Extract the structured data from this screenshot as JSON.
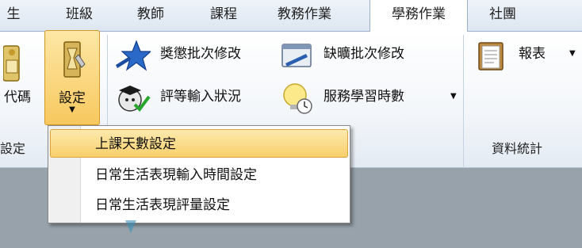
{
  "tabs": [
    {
      "label": "生"
    },
    {
      "label": "班級"
    },
    {
      "label": "教師"
    },
    {
      "label": "課程"
    },
    {
      "label": "教務作業"
    },
    {
      "label": "學務作業"
    },
    {
      "label": "社團"
    }
  ],
  "ribbon": {
    "code_button": {
      "label": "代碼"
    },
    "settings_button": {
      "label": "設定"
    },
    "reward_batch": {
      "label": "獎懲批次修改"
    },
    "absence_batch": {
      "label": "缺曠批次修改"
    },
    "rating_status": {
      "label": "評等輸入狀況"
    },
    "service_hours": {
      "label": "服務學習時數"
    },
    "report": {
      "label": "報表"
    },
    "groups": {
      "settings": "設定",
      "stats": "資料統計"
    }
  },
  "menu": {
    "items": [
      {
        "label": "上課天數設定"
      },
      {
        "label": "日常生活表現輸入時間設定"
      },
      {
        "label": "日常生活表現評量設定"
      }
    ]
  }
}
